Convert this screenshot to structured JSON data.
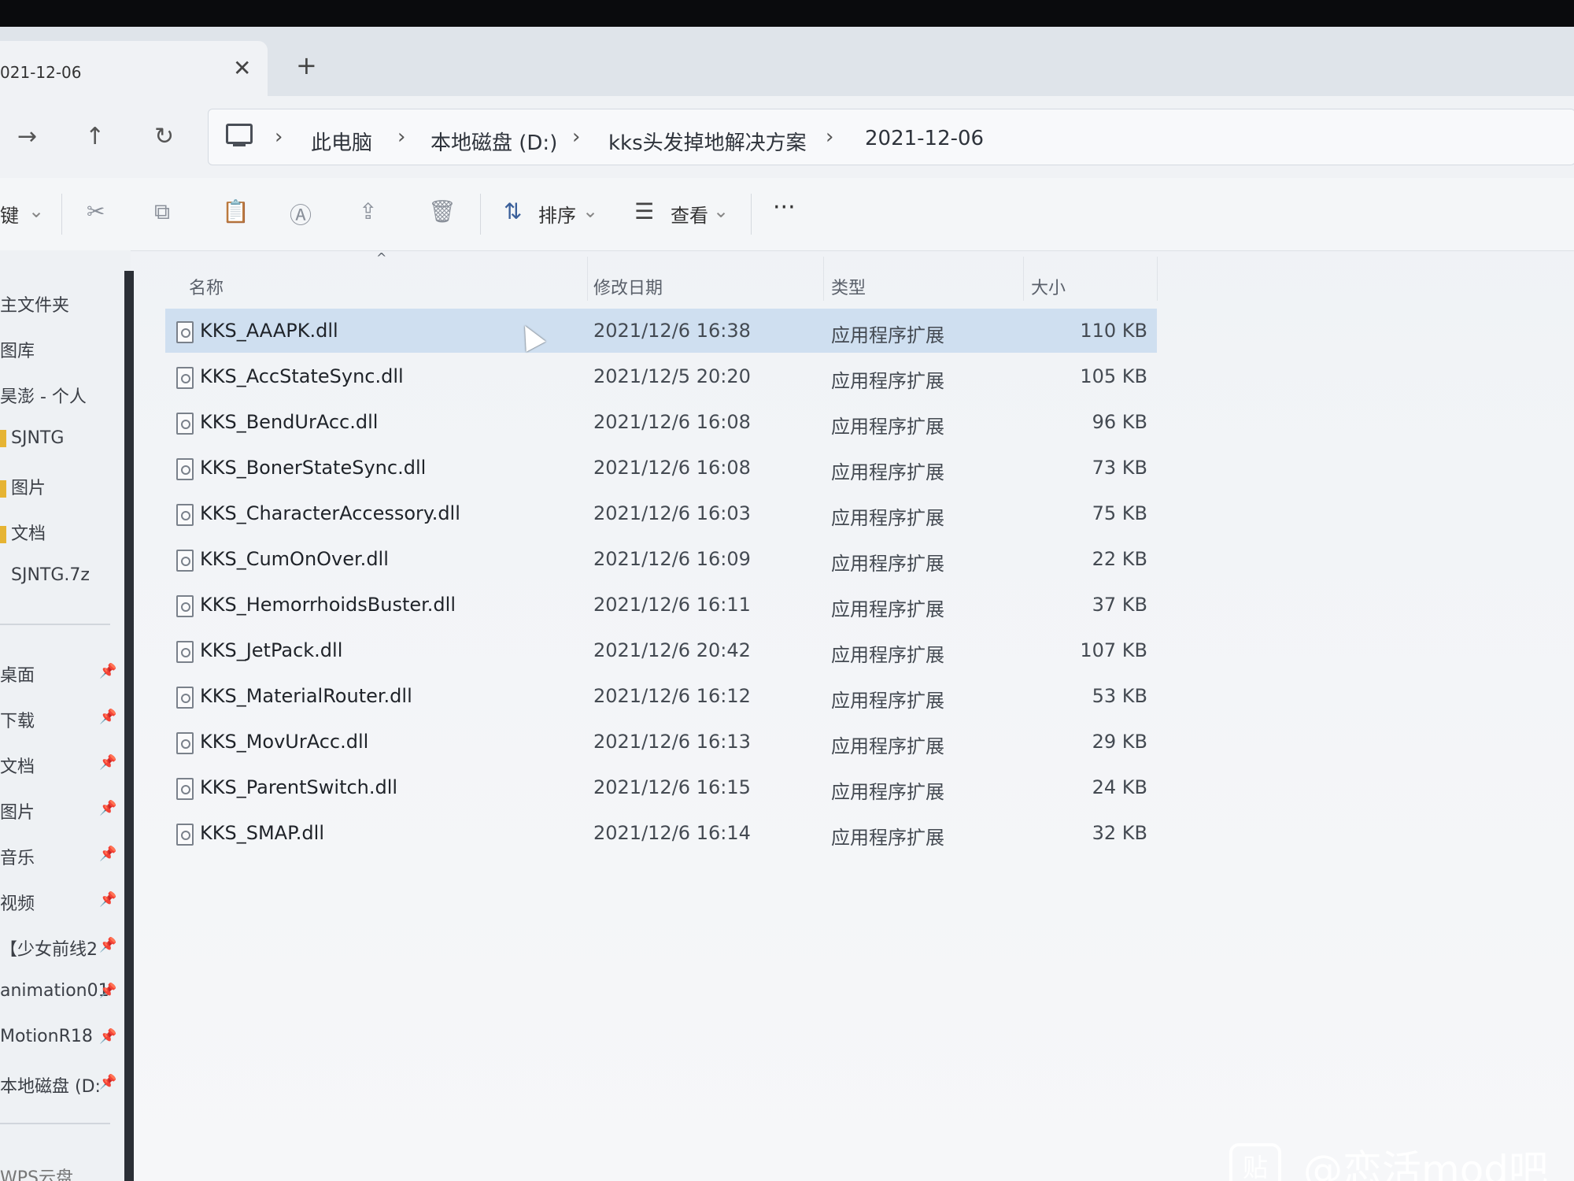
{
  "tab": {
    "title": "021-12-06",
    "close": "✕",
    "new": "+"
  },
  "nav": {
    "back": "←",
    "forward": "→",
    "up": "↑",
    "refresh": "↻"
  },
  "breadcrumb": [
    "此电脑",
    "本地磁盘 (D:)",
    "kks头发掉地解决方案",
    "2021-12-06"
  ],
  "toolbar": {
    "new_label": "键",
    "sort_label": "排序",
    "view_label": "查看",
    "more_label": "···"
  },
  "columns": {
    "name": "名称",
    "modified": "修改日期",
    "type": "类型",
    "size": "大小"
  },
  "files": [
    {
      "name": "KKS_AAAPK.dll",
      "modified": "2021/12/6 16:38",
      "type": "应用程序扩展",
      "size": "110 KB"
    },
    {
      "name": "KKS_AccStateSync.dll",
      "modified": "2021/12/5 20:20",
      "type": "应用程序扩展",
      "size": "105 KB"
    },
    {
      "name": "KKS_BendUrAcc.dll",
      "modified": "2021/12/6 16:08",
      "type": "应用程序扩展",
      "size": "96 KB"
    },
    {
      "name": "KKS_BonerStateSync.dll",
      "modified": "2021/12/6 16:08",
      "type": "应用程序扩展",
      "size": "73 KB"
    },
    {
      "name": "KKS_CharacterAccessory.dll",
      "modified": "2021/12/6 16:03",
      "type": "应用程序扩展",
      "size": "75 KB"
    },
    {
      "name": "KKS_CumOnOver.dll",
      "modified": "2021/12/6 16:09",
      "type": "应用程序扩展",
      "size": "22 KB"
    },
    {
      "name": "KKS_HemorrhoidsBuster.dll",
      "modified": "2021/12/6 16:11",
      "type": "应用程序扩展",
      "size": "37 KB"
    },
    {
      "name": "KKS_JetPack.dll",
      "modified": "2021/12/6 20:42",
      "type": "应用程序扩展",
      "size": "107 KB"
    },
    {
      "name": "KKS_MaterialRouter.dll",
      "modified": "2021/12/6 16:12",
      "type": "应用程序扩展",
      "size": "53 KB"
    },
    {
      "name": "KKS_MovUrAcc.dll",
      "modified": "2021/12/6 16:13",
      "type": "应用程序扩展",
      "size": "29 KB"
    },
    {
      "name": "KKS_ParentSwitch.dll",
      "modified": "2021/12/6 16:15",
      "type": "应用程序扩展",
      "size": "24 KB"
    },
    {
      "name": "KKS_SMAP.dll",
      "modified": "2021/12/6 16:14",
      "type": "应用程序扩展",
      "size": "32 KB"
    }
  ],
  "sidebar": {
    "top": [
      "主文件夹",
      "图库",
      "昊澎 - 个人",
      "SJNTG",
      "图片",
      "文档",
      "SJNTG.7z"
    ],
    "pinned": [
      "桌面",
      "下载",
      "文档",
      "图片",
      "音乐",
      "视频",
      "【少女前线2",
      "animation01",
      "MotionR18",
      "本地磁盘 (D:"
    ],
    "bottom": "WPS云盘"
  },
  "watermark": {
    "badge": "贴",
    "text": "@恋活mod吧"
  }
}
